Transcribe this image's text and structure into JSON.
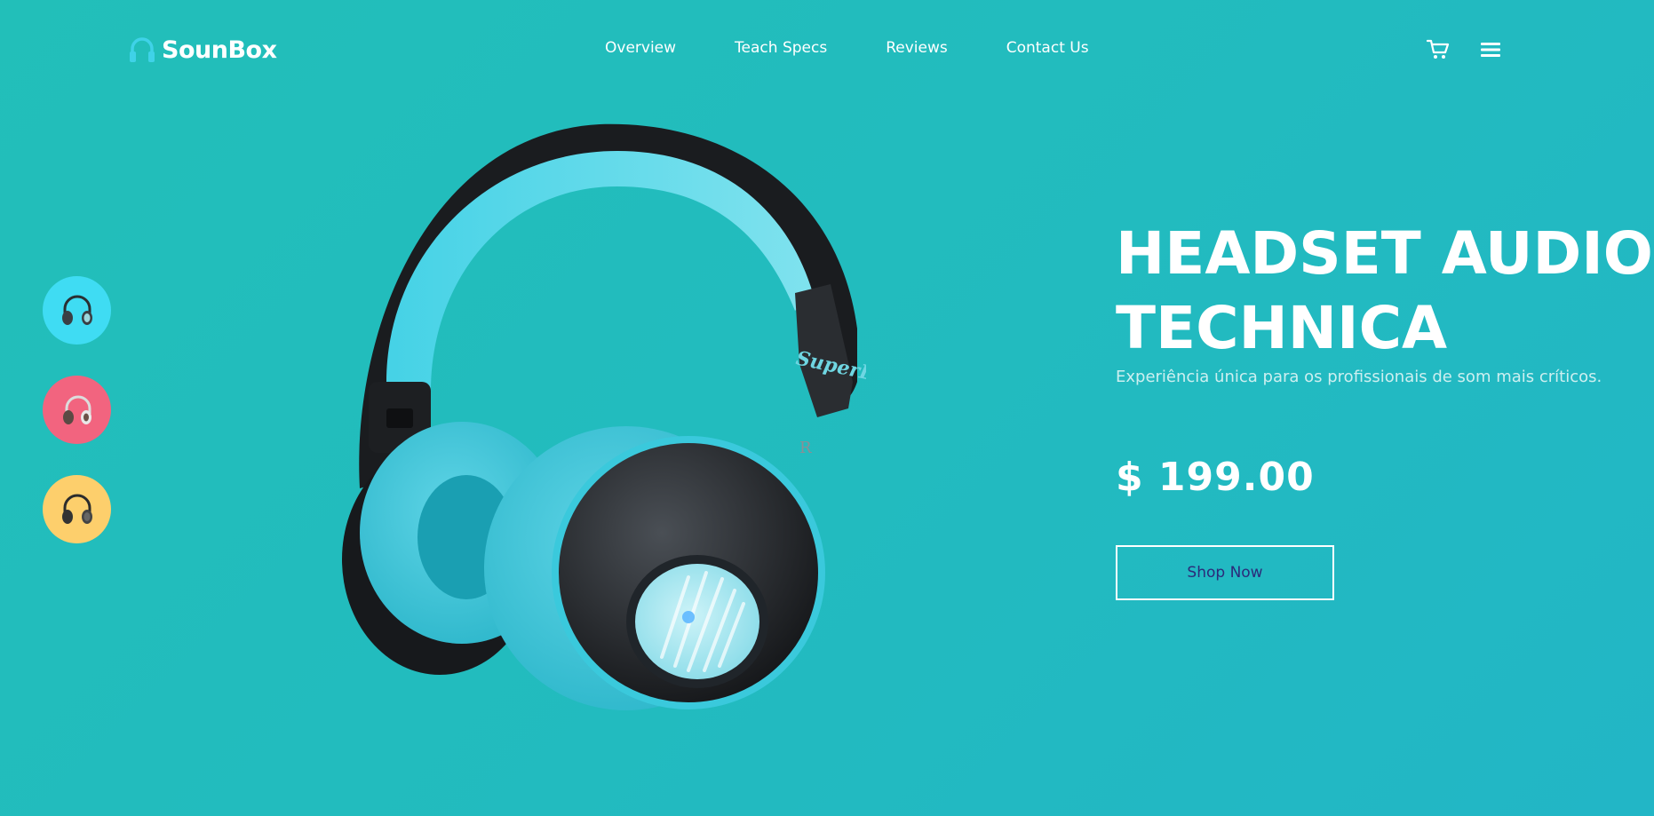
{
  "brand": {
    "name": "SounBox",
    "logo_icon": "headphones-icon"
  },
  "nav": {
    "items": [
      {
        "label": "Overview"
      },
      {
        "label": "Teach Specs"
      },
      {
        "label": "Reviews"
      },
      {
        "label": "Contact Us"
      }
    ]
  },
  "header_actions": {
    "cart_icon": "cart-icon",
    "menu_icon": "hamburger-menu-icon"
  },
  "color_options": [
    {
      "name": "headphone-teal",
      "color": "#3fdcf3"
    },
    {
      "name": "headphone-pink",
      "color": "#f2647f"
    },
    {
      "name": "headphone-yellow",
      "color": "#fdcf6c"
    }
  ],
  "product": {
    "title_line1": "HEADSET AUDIO",
    "title_line2": "TECHNICA",
    "subtitle": "Experiência única para os profissionais de som mais críticos.",
    "price": "$ 199.00",
    "cta_label": "Shop Now",
    "earcup_brand": "SuperEQ",
    "earcup_side": "R"
  },
  "colors": {
    "background": "#22bdbd",
    "accent": "#3fd2e8",
    "cta_text": "#2c2a7a"
  }
}
